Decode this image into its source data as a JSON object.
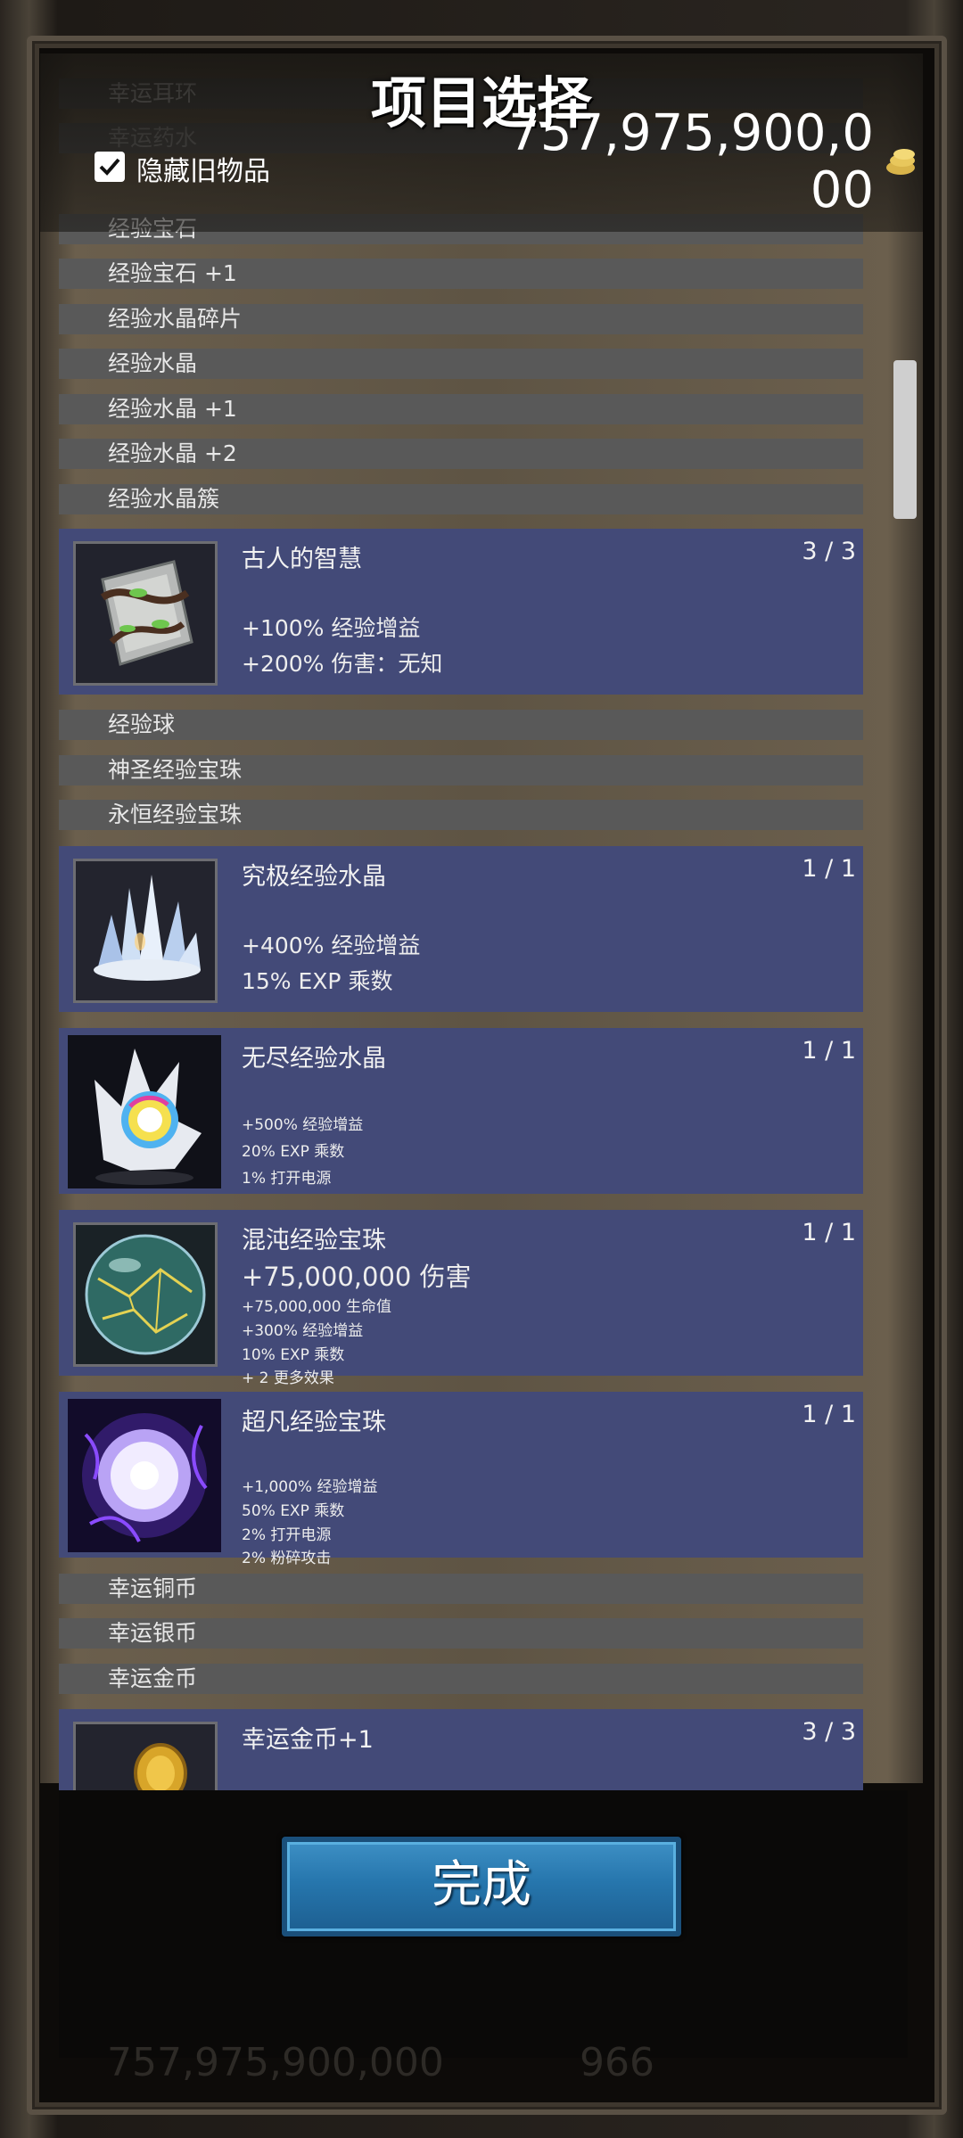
{
  "header": {
    "title": "项目选择",
    "hide_old_label": "隐藏旧物品",
    "hide_old_checked": true,
    "gold_amount": "757,975,900,000"
  },
  "list": {
    "simple_items_top": [
      "幸运耳环",
      "幸运药水",
      "经验宝石",
      "经验宝石 +1",
      "经验水晶碎片",
      "经验水晶",
      "经验水晶 +1",
      "经验水晶 +2",
      "经验水晶簇"
    ],
    "card_ancient": {
      "title": "古人的智慧",
      "count": "3 / 3",
      "effects": [
        "+100% 经验增益",
        "+200% 伤害：无知"
      ],
      "icon": "ancient-book-icon"
    },
    "simple_items_mid": [
      "经验球",
      "神圣经验宝珠",
      "永恒经验宝珠"
    ],
    "card_ultimate": {
      "title": "究极经验水晶",
      "count": "1 / 1",
      "effects": [
        "+400% 经验增益",
        "15% EXP 乘数"
      ],
      "icon": "crystal-cluster-icon"
    },
    "card_endless": {
      "title": "无尽经验水晶",
      "count": "1 / 1",
      "effects": [
        "+500% 经验增益",
        "20% EXP 乘数",
        "1% 打开电源"
      ],
      "icon": "rainbow-crystal-icon"
    },
    "card_chaos": {
      "title": "混沌经验宝珠",
      "count": "1 / 1",
      "headline": "+75,000,000 伤害",
      "effects": [
        "+75,000,000 生命值",
        "+300% 经验增益",
        "10% EXP 乘数",
        "+ 2 更多效果"
      ],
      "icon": "chaos-orb-icon"
    },
    "card_transcend": {
      "title": "超凡经验宝珠",
      "count": "1 / 1",
      "effects": [
        "+1,000% 经验增益",
        "50% EXP 乘数",
        "2% 打开电源",
        "2% 粉碎攻击"
      ],
      "icon": "transcendent-orb-icon"
    },
    "simple_items_bottom": [
      "幸运铜币",
      "幸运银币",
      "幸运金币"
    ],
    "card_lucky_gold": {
      "title": "幸运金币+1",
      "count": "3 / 3",
      "icon": "gold-coins-icon"
    }
  },
  "footer": {
    "done_label": "完成",
    "background_gold": "757,975,900,000",
    "background_number": "966"
  },
  "colors": {
    "card_bg": "#434a78",
    "row_bg": "#595959",
    "button_blue": "#2676ad"
  }
}
